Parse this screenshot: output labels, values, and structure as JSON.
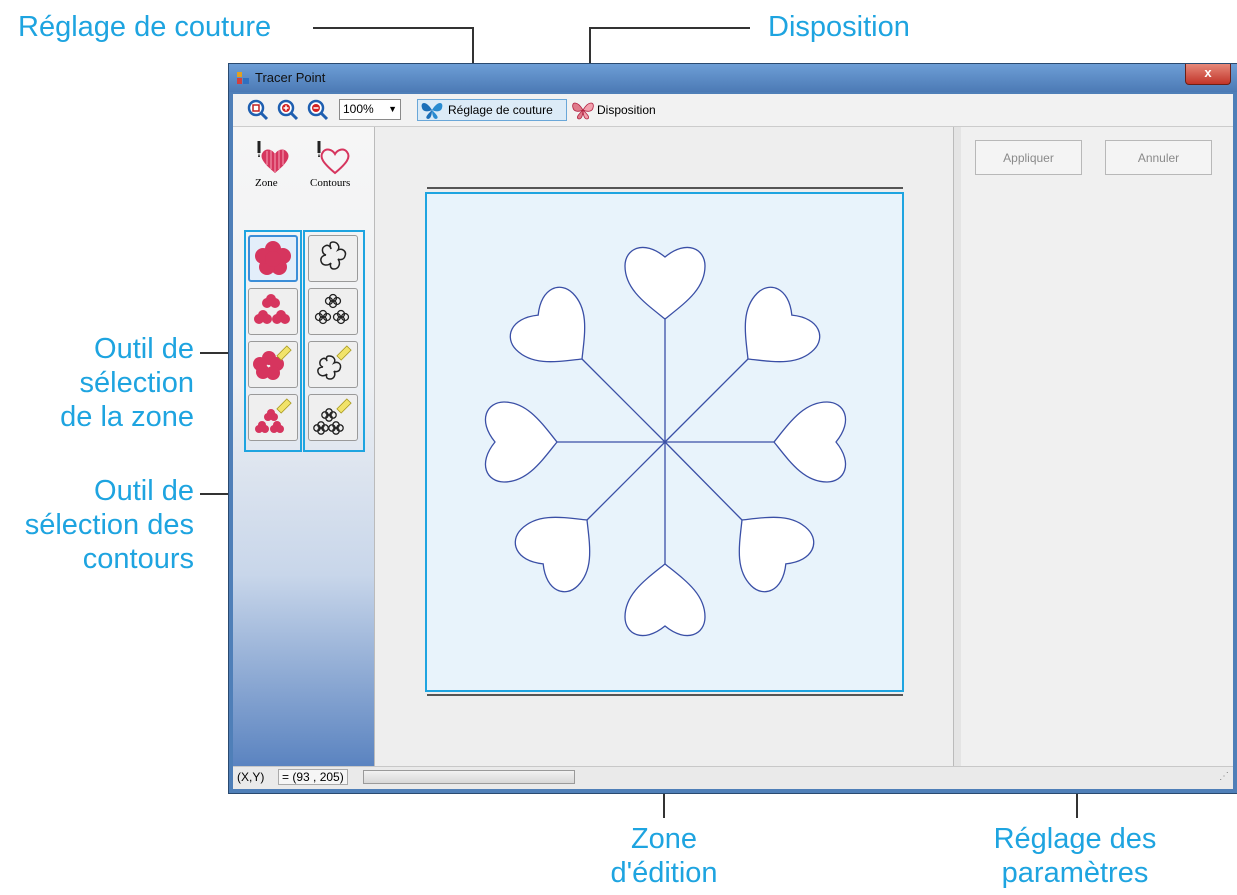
{
  "callouts": {
    "stitch_setting": "Réglage de couture",
    "layout": "Disposition",
    "area_tool": [
      "Outil de",
      "sélection",
      "de la zone"
    ],
    "outline_tool": [
      "Outil de",
      "sélection des",
      "contours"
    ],
    "edit_zone": [
      "Zone",
      "d'édition"
    ],
    "param_setting": [
      "Réglage des",
      "paramètres"
    ]
  },
  "window": {
    "title": "Tracer Point",
    "close_label": "x"
  },
  "toolbar": {
    "zoom_value": "100%",
    "stitch_label": "Réglage de couture",
    "layout_label": "Disposition"
  },
  "left_panel": {
    "zone_label": "Zone",
    "contours_label": "Contours"
  },
  "params": {
    "apply_label": "Appliquer",
    "cancel_label": "Annuler"
  },
  "status": {
    "coord_label": "(X,Y)",
    "coord_value": "= (93 , 205)"
  },
  "colors": {
    "accent": "#1ea4e0",
    "design_line": "#3a4fa6",
    "canvas_bg": "#e8f3fb",
    "flower": "#d6355e"
  }
}
